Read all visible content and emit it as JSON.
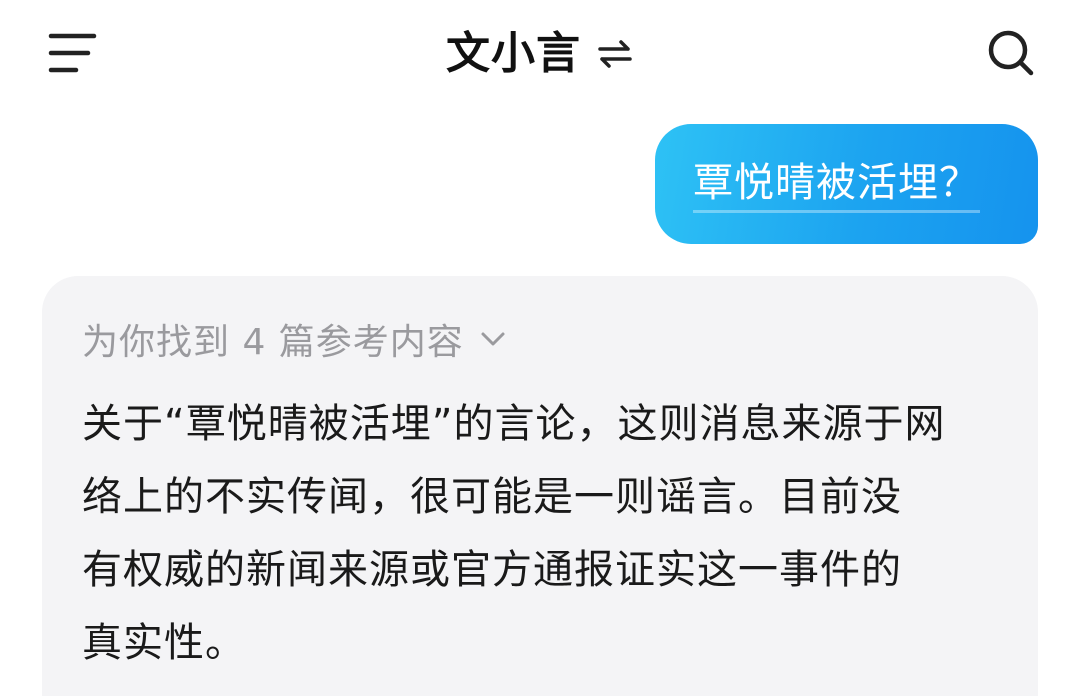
{
  "header": {
    "title": "文小言",
    "menu_icon": "menu-icon",
    "switch_icon": "switch-arrows-icon",
    "search_icon": "search-icon"
  },
  "conversation": {
    "user_message": "覃悦晴被活埋？",
    "reply": {
      "references_label": "为你找到 4 篇参考内容",
      "lines": [
        "关于“覃悦晴被活埋”的言论，这则消息来源于网",
        "络上的不实传闻，很可能是一则谣言。目前没",
        "有权威的新闻来源或官方通报证实这一事件的",
        "真实性。"
      ]
    }
  },
  "colors": {
    "user_bubble_start": "#2ec2f5",
    "user_bubble_end": "#1593ee",
    "reply_background": "#f4f4f6",
    "muted_text": "#9a9a9e"
  }
}
